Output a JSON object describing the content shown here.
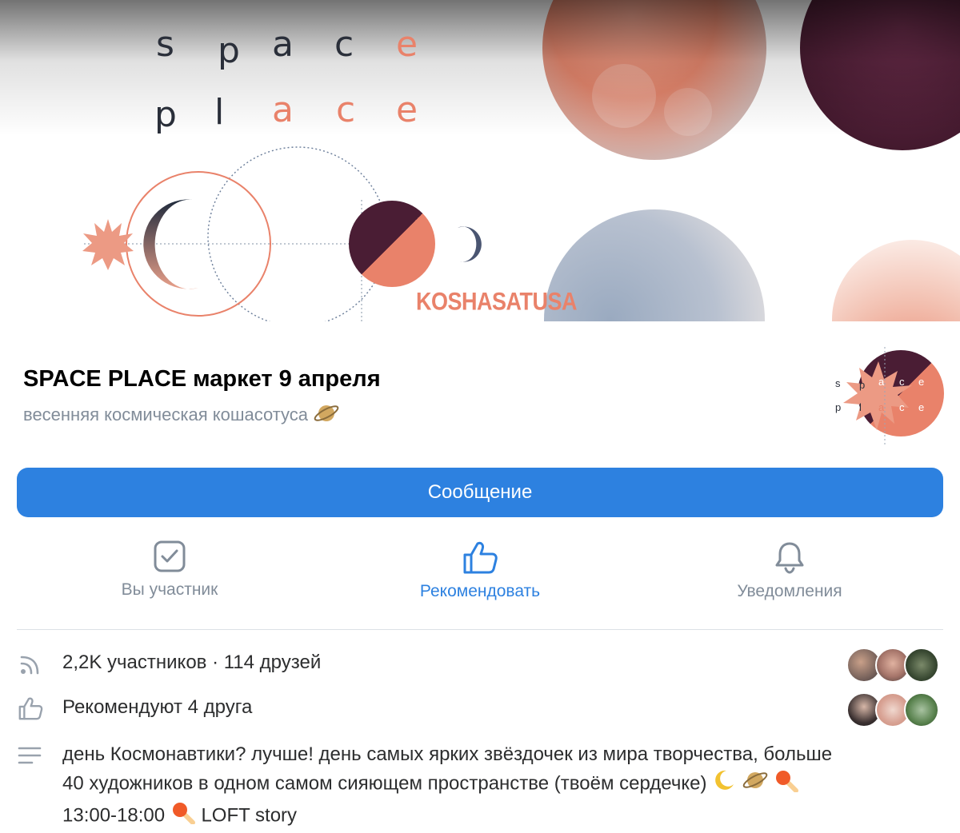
{
  "cover": {
    "letters_row1": [
      "s",
      "p",
      "a",
      "c",
      "e"
    ],
    "letters_row2": [
      "p",
      "l",
      "a",
      "c",
      "e"
    ],
    "brand_text": "KOSHASATUSA"
  },
  "header": {
    "title": "SPACE PLACE маркет 9 апреля",
    "subtitle": "весенняя космическая кошасотуса",
    "subtitle_emoji": "saturn-icon",
    "avatar_letters_row1": [
      "s",
      "p",
      "a",
      "c",
      "e"
    ],
    "avatar_letters_row2": [
      "p",
      "l",
      "a",
      "c",
      "e"
    ]
  },
  "message_button": {
    "label": "Сообщение"
  },
  "actions": [
    {
      "label": "Вы участник",
      "icon": "checkbox-icon",
      "color": "#818c99"
    },
    {
      "label": "Рекомендовать",
      "icon": "thumbs-up-icon",
      "color": "#2d81e0"
    },
    {
      "label": "Уведомления",
      "icon": "bell-icon",
      "color": "#818c99"
    }
  ],
  "info": {
    "members": "2,2K участников · 114 друзей",
    "recommend": "Рекомендуют 4 друга",
    "description_line1": "день Космонавтики? лучше! день самых ярких звёздочек из мира творчества, больше",
    "description_line2": "40 художников в одном самом сияющем пространстве (твоём сердечке)",
    "description_line3_time": "13:00-18:00",
    "description_line3_place": "LOFT story"
  },
  "colors": {
    "accent": "#2d81e0",
    "secondary_text": "#818c99",
    "salmon": "#e9826a",
    "plum": "#4a1d34"
  }
}
